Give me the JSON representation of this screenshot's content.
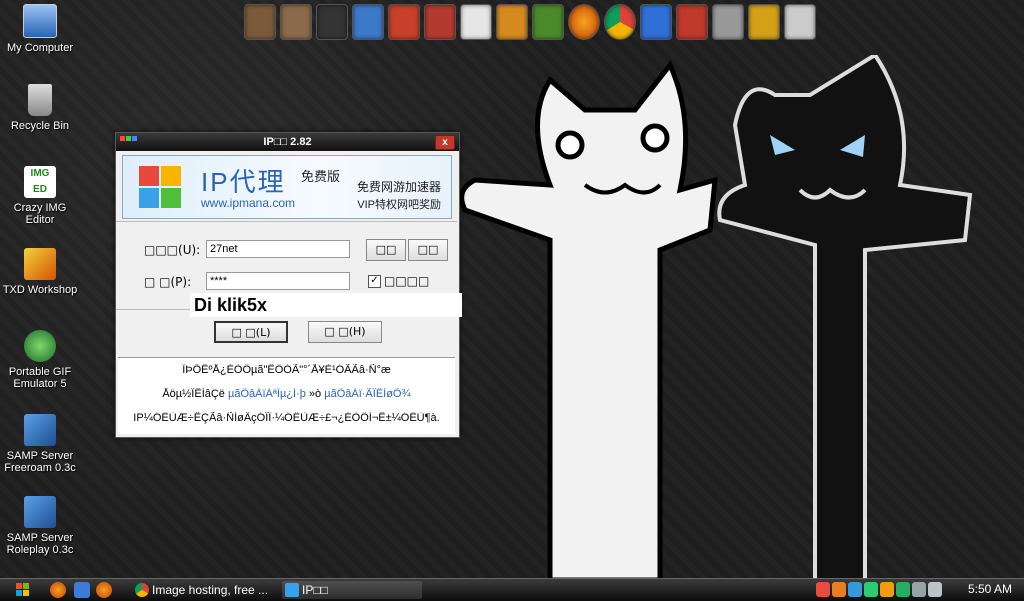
{
  "desktop": {
    "icons": [
      {
        "label": "My Computer"
      },
      {
        "label": "Recycle Bin"
      },
      {
        "label": "Crazy IMG Editor"
      },
      {
        "label": "TXD Workshop"
      },
      {
        "label": "Portable GIF Emulator 5"
      },
      {
        "label": "SAMP Server Freeroam 0.3c"
      },
      {
        "label": "SAMP Server Roleplay 0.3c"
      }
    ],
    "crazy_img_badge": "IMG ED"
  },
  "dock": {
    "icons": [
      "avatar-icon",
      "avatar-icon",
      "crossfire-icon",
      "game-icon",
      "game-icon",
      "game-icon",
      "stamp-icon",
      "game-icon",
      "game-icon",
      "firefox-icon",
      "chrome-icon",
      "app-icon",
      "app-icon",
      "tools-icon",
      "tools-icon",
      "recycle-icon"
    ]
  },
  "window": {
    "title": "IP□□ 2.82",
    "close": "x",
    "banner": {
      "brand": "IP代理",
      "free": "免费版",
      "url": "www.ipmana.com",
      "tag1": "免费网游加速器",
      "tag2": "VIP特权网吧奖励"
    },
    "username_label": "□□□(U):",
    "username_value": "27net",
    "password_label": "□ □(P):",
    "password_value": "****",
    "btn_a": "□□",
    "btn_b": "□□",
    "remember_label": "□□□□",
    "remember_check": "✓",
    "login_btn": "□ □(L)",
    "help_btn": "□ □(H)",
    "notice": {
      "line1": "ÏÞÕÊºÅ¿ÉÒÔµã\"ÊÔÓÃ\"°´Å¥È¹ÓÃÃâ·Ñ°æ",
      "line2_a": "Åöµ½ÎÊÌâÇë ",
      "line2_b": "µãÕâÀïÁªÏµ¿Í·þ",
      "line2_c": " »ò ",
      "line2_d": "µãÕâÀï·ÃÎÊÍøÕ¾",
      "line3": "IP¼ÓËÙÆ÷ÊÇÃâ·ÑÍøÂçÓÎÏ·¼ÓËÙÆ÷£¬¿ÉÒÔÍ¬Ê±¼ÓËÙ¶à."
    }
  },
  "annotation": {
    "text": "Di klik5x"
  },
  "taskbar": {
    "tasks": [
      {
        "label": "Image hosting, free ..."
      },
      {
        "label": "IP□□"
      }
    ],
    "clock": "5:50 AM"
  },
  "colors": {
    "accent": "#2a63b5",
    "titlebar": "#111111",
    "close": "#c0392b"
  }
}
